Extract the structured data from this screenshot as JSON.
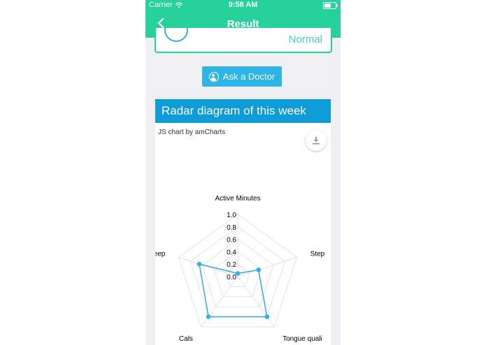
{
  "status_bar": {
    "carrier": "Carrier",
    "time": "9:58 AM"
  },
  "nav": {
    "title": "Result"
  },
  "result_card": {
    "status": "Normal"
  },
  "ask_button": {
    "label": "Ask a Doctor"
  },
  "radar_section": {
    "title": "Radar diagram of this week",
    "credit": "JS chart by amCharts"
  },
  "colors": {
    "header": "#27d19b",
    "button": "#2cb5e6",
    "section": "#0d9cd8",
    "series": "#3aaee0"
  },
  "chart_data": {
    "type": "radar",
    "axes": [
      "Active Minutes",
      "Steps",
      "Tongue quali",
      "Cals",
      "Sleep"
    ],
    "axis_labels_visible": [
      "Active Minutes",
      "Step",
      "Tongue quali",
      "Cals",
      "leep"
    ],
    "ticks": [
      "0.0",
      "0.2",
      "0.4",
      "0.6",
      "0.8",
      "1.0"
    ],
    "ylim": [
      0,
      1
    ],
    "values": [
      0.05,
      0.35,
      0.8,
      0.8,
      0.65
    ]
  }
}
